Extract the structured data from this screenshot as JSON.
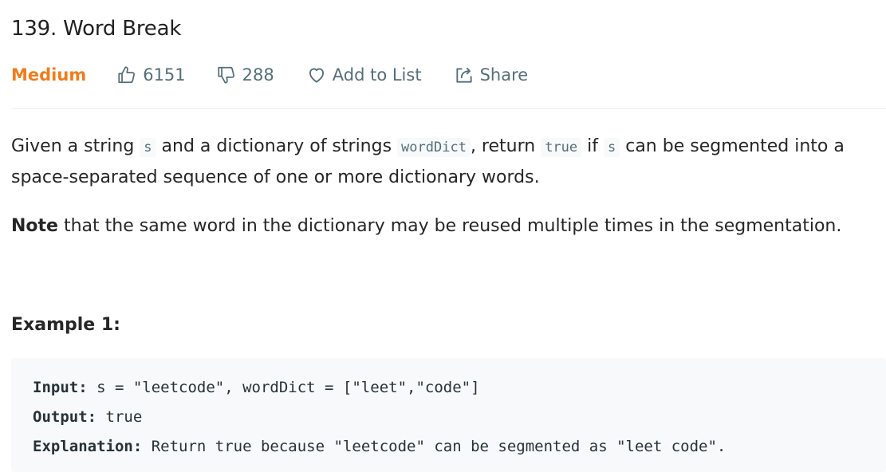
{
  "problem": {
    "title": "139. Word Break",
    "difficulty": "Medium",
    "likes": "6151",
    "dislikes": "288",
    "add_to_list_label": "Add to List",
    "share_label": "Share"
  },
  "description": {
    "p1_a": "Given a string ",
    "p1_code_s": "s",
    "p1_b": " and a dictionary of strings ",
    "p1_code_worddict": "wordDict",
    "p1_c": ", return ",
    "p1_code_true": "true",
    "p1_d": " if ",
    "p1_code_s2": "s",
    "p1_e": " can be segmented into a space-separated sequence of one or more dictionary words.",
    "note_bold": "Note",
    "note_rest": " that the same word in the dictionary may be reused multiple times in the segmentation."
  },
  "example1": {
    "title": "Example 1:",
    "input_label": "Input:",
    "input_value": " s = \"leetcode\", wordDict = [\"leet\",\"code\"]",
    "output_label": "Output:",
    "output_value": " true",
    "explanation_label": "Explanation:",
    "explanation_value": " Return true because \"leetcode\" can be segmented as \"leet code\"."
  },
  "icons": {
    "like": "thumbs-up-icon",
    "dislike": "thumbs-down-icon",
    "add_to_list": "heart-icon",
    "share": "share-icon"
  },
  "colors": {
    "difficulty_medium": "#ef7d1c",
    "meta_text": "#546e7a",
    "code_bg": "#f7f9fa"
  }
}
